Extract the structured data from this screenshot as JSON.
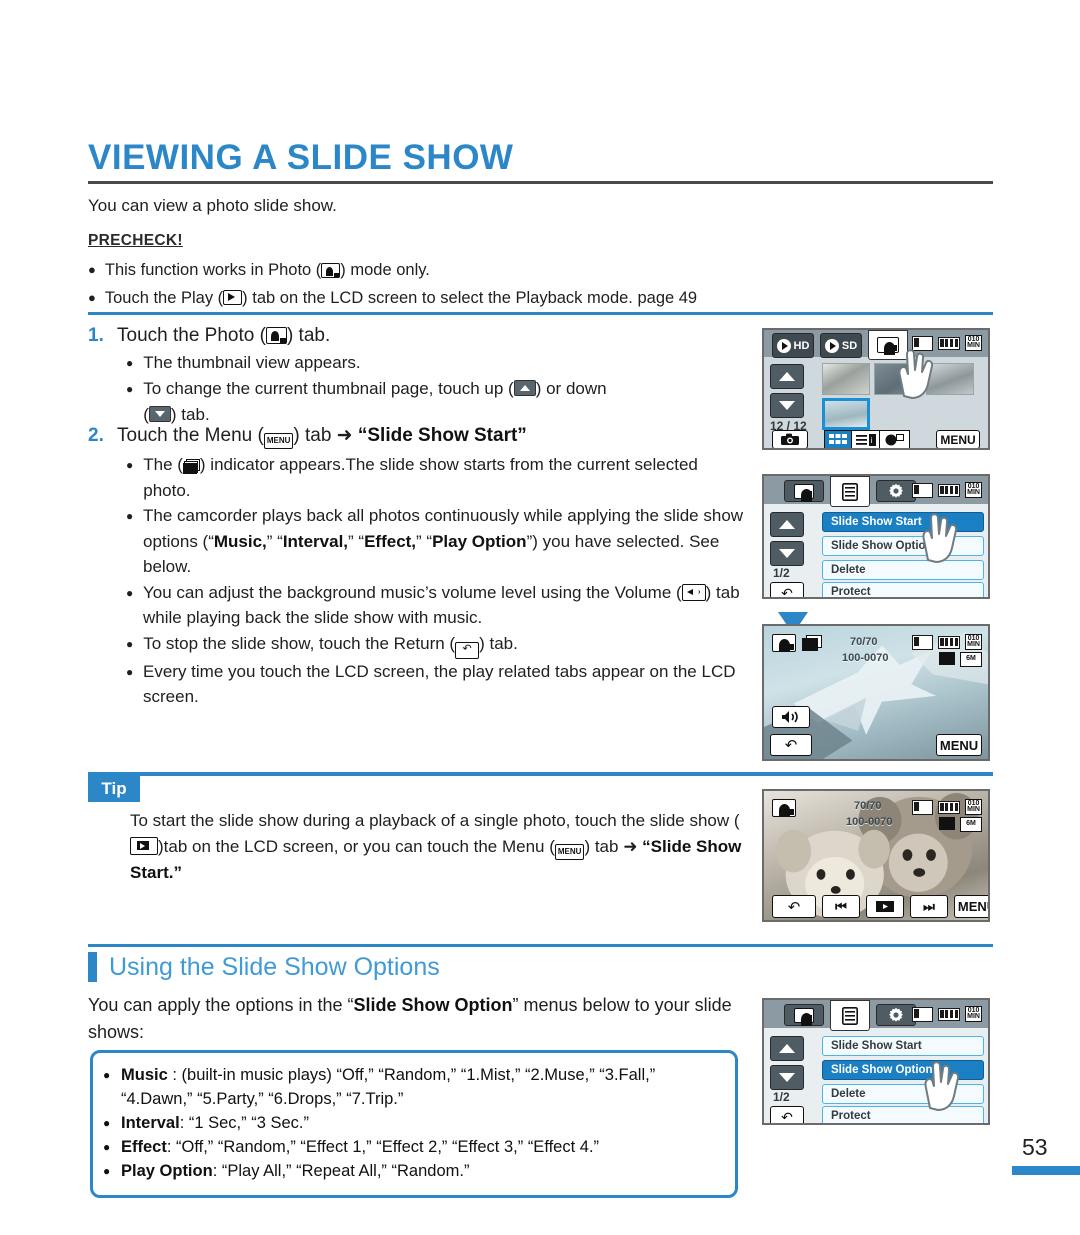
{
  "page": {
    "number": "53",
    "title": "VIEWING A SLIDE SHOW",
    "intro": "You can view a photo slide show.",
    "accent_color": "#2c87c9",
    "heading_color": "#3f9ad6"
  },
  "precheck": {
    "label": "PRECHECK!",
    "items": [
      "This function works in Photo (▣) mode only.",
      "Touch the Play (▶) tab on the LCD screen to select the Playback mode. ➝page 49"
    ],
    "item1_pre": "This function works in Photo (",
    "item1_post": ") mode only.",
    "item2_pre": "Touch the Play (",
    "item2_post": ") tab on the LCD screen to select the Playback mode. ",
    "item2_ref": "page 49"
  },
  "steps": [
    {
      "num": "1.",
      "pre": "Touch the Photo (",
      "post": ") tab.",
      "subs": [
        {
          "text": "The thumbnail view appears."
        },
        {
          "pre": "To change the current thumbnail page, touch up (",
          "mid": ") or down",
          "post2": ") tab."
        }
      ]
    },
    {
      "num": "2.",
      "pre": "Touch the Menu (",
      "mid": ") tab ➜ ",
      "bold": "“Slide Show Start”",
      "subs": [
        {
          "pre": "The (",
          "post": ") indicator appears.The slide show starts from the current selected photo."
        },
        {
          "text_a": "The camcorder plays back all photos continuously while applying the slide show options (“",
          "b1": "Music,",
          "t1": "” “",
          "b2": "Interval,",
          "t2": "” “",
          "b3": "Effect,",
          "t3": "” “",
          "b4": "Play Option",
          "t4": "”) you have selected. See below."
        },
        {
          "pre": "You can adjust the background music’s volume level using the Volume (",
          "post": ") tab while playing back the slide show with music."
        },
        {
          "pre": "To stop the slide show, touch the Return (",
          "post": ") tab."
        },
        {
          "text": "Every time you touch the LCD screen, the play related tabs appear on the LCD screen."
        }
      ]
    }
  ],
  "tip": {
    "badge": "Tip",
    "pre": "To start the slide show during a playback of a single photo, touch the slide show (",
    "mid": ")tab on the LCD screen, or you can touch the Menu (",
    "post": ") tab ➜ ",
    "bold": "“Slide Show Start.”"
  },
  "section": {
    "heading": "Using the Slide Show Options",
    "intro_pre": "You can apply the options in the “",
    "intro_bold": "Slide Show Option",
    "intro_post": "” menus below to your slide shows:"
  },
  "options": [
    {
      "label": "Music",
      "sep": " : ",
      "values": "(built-in music plays) “Off,” “Random,” “1.Mist,” “2.Muse,” “3.Fall,” “4.Dawn,” “5.Party,” “6.Drops,” “7.Trip.”"
    },
    {
      "label": "Interval",
      "sep": ": ",
      "values": "“1 Sec,” “3 Sec.”"
    },
    {
      "label": "Effect",
      "sep": ": ",
      "values": "“Off,” “Random,” “Effect 1,” “Effect 2,” “Effect 3,” “Effect 4.”"
    },
    {
      "label": "Play Option",
      "sep": ": ",
      "values": "“Play All,” “Repeat All,” “Random.”"
    }
  ],
  "screens": {
    "thumbnail": {
      "tabs": [
        {
          "label": "HD",
          "selected": false
        },
        {
          "label": "SD",
          "selected": false
        },
        {
          "label": "",
          "selected": true,
          "icon": "photo-icon"
        }
      ],
      "counter": "12 / 12",
      "menu_label": "MENU"
    },
    "menu_start": {
      "rows": [
        {
          "label": "Slide Show Start",
          "highlighted": true
        },
        {
          "label": "Slide Show Option",
          "highlighted": false
        },
        {
          "label": "Delete",
          "highlighted": false
        },
        {
          "label": "Protect",
          "highlighted": false
        }
      ],
      "page": "1/2"
    },
    "slideshow_play": {
      "counter": "70/70",
      "file": "100-0070",
      "menu_label": "MENU"
    },
    "single_photo": {
      "counter": "70/70",
      "file": "100-0070",
      "menu_label": "MENU"
    },
    "menu_option": {
      "rows": [
        {
          "label": "Slide Show Start",
          "highlighted": false
        },
        {
          "label": "Slide Show Option",
          "highlighted": true
        },
        {
          "label": "Delete",
          "highlighted": false
        },
        {
          "label": "Protect",
          "highlighted": false
        }
      ],
      "page": "1/2"
    }
  }
}
